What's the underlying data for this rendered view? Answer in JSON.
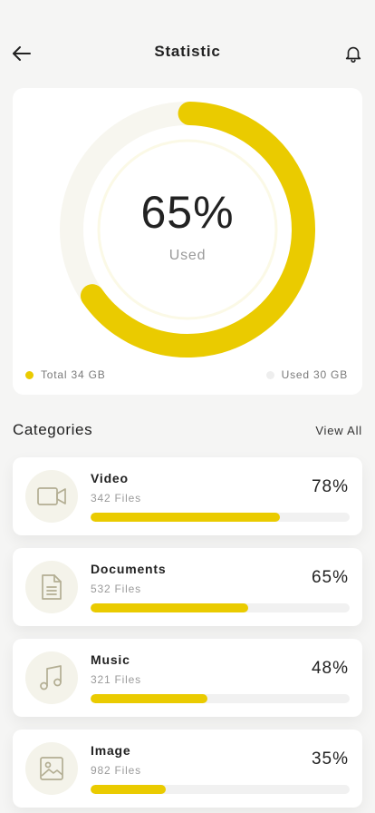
{
  "header": {
    "title": "Statistic",
    "back_icon": "arrow-left-icon",
    "bell_icon": "bell-icon"
  },
  "usage": {
    "percent_label": "65%",
    "percent_value": 0.65,
    "caption": "Used",
    "total_label": "Total 34 GB",
    "used_label": "Used 30 GB"
  },
  "colors": {
    "accent": "#eacb00",
    "track": "#f7f6ef",
    "used_dot": "#eacb00",
    "total_dot": "#eeeeee"
  },
  "categories": {
    "title": "Categories",
    "view_all": "View All",
    "items": [
      {
        "name": "Video",
        "files": "342 Files",
        "percent": "78%",
        "fill": 0.73,
        "icon": "video-icon"
      },
      {
        "name": "Documents",
        "files": "532 Files",
        "percent": "65%",
        "fill": 0.61,
        "icon": "document-icon"
      },
      {
        "name": "Music",
        "files": "321 Files",
        "percent": "48%",
        "fill": 0.45,
        "icon": "music-icon"
      },
      {
        "name": "Image",
        "files": "982 Files",
        "percent": "35%",
        "fill": 0.29,
        "icon": "image-icon"
      }
    ]
  }
}
